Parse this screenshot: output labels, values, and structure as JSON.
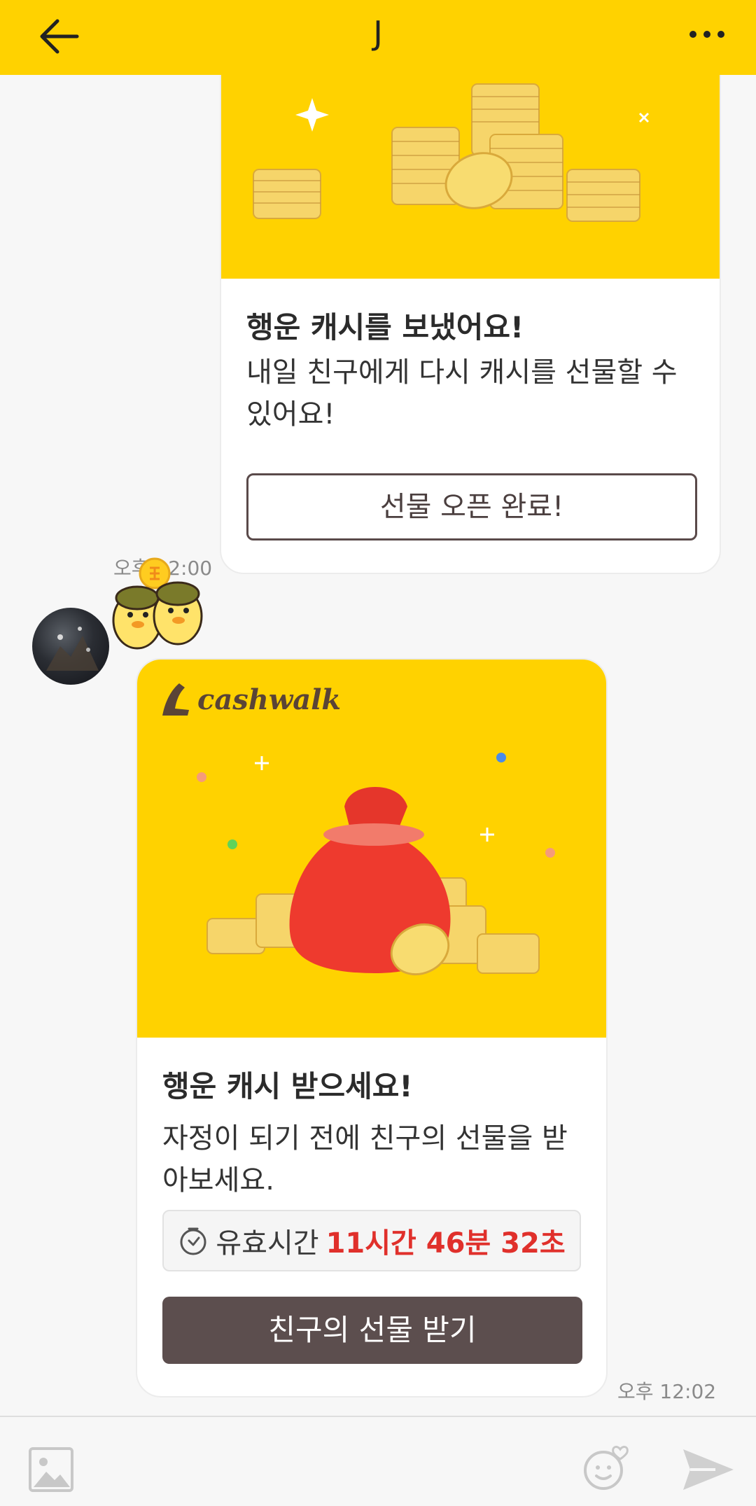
{
  "header": {
    "title": "J"
  },
  "sent_card": {
    "title": "행운 캐시를 보냈어요!",
    "body": "내일 친구에게 다시 캐시를 선물할 수 있어요!",
    "button_label": "선물 오픈 완료!",
    "timestamp": "오후 12:00"
  },
  "received_card": {
    "brand": "cashwalk",
    "title": "행운 캐시 받으세요!",
    "body": "자정이 되기 전에 친구의 선물을 받아보세요.",
    "timer_label": "유효시간",
    "timer_value": "11시간 46분 32초",
    "button_label": "친구의 선물 받기",
    "timestamp": "오후 12:02"
  },
  "colors": {
    "header": "#ffd200",
    "accent_red": "#e0302b",
    "primary_button": "#5c4e4e"
  },
  "icons": [
    "back-arrow-icon",
    "more-dots-icon",
    "image-icon",
    "emoji-icon",
    "send-icon",
    "timer-icon"
  ]
}
